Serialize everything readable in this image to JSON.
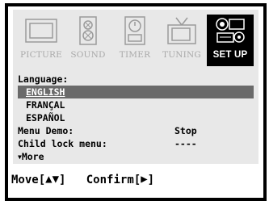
{
  "tabs": [
    {
      "label": "PICTURE",
      "icon": "monitor-icon"
    },
    {
      "label": "SOUND",
      "icon": "speaker-icon"
    },
    {
      "label": "TIMER",
      "icon": "timer-icon"
    },
    {
      "label": "TUNING",
      "icon": "tv-antenna-icon"
    },
    {
      "label": "SET UP",
      "icon": "setup-icon",
      "active": true
    }
  ],
  "menu": {
    "language_label": "Language:",
    "options": [
      "ENGLISH",
      "FRANÇAL",
      "ESPAÑOL"
    ],
    "selected_option": "ENGLISH",
    "menu_demo_label": "Menu Demo:",
    "menu_demo_value": "Stop",
    "child_lock_label": "Child lock menu:",
    "child_lock_value": "----",
    "more_label": "More"
  },
  "footer": {
    "move_label": "Move[",
    "move_arrows": "▲▼",
    "move_close": "]",
    "confirm_label": "Confirm[",
    "confirm_arrow": "▶",
    "confirm_close": "]"
  },
  "colors": {
    "panel": "#e8e8e8",
    "selected_bg": "#6a6a6a",
    "inactive_text": "#a9a9a9",
    "active_tab_bg": "#000000"
  }
}
